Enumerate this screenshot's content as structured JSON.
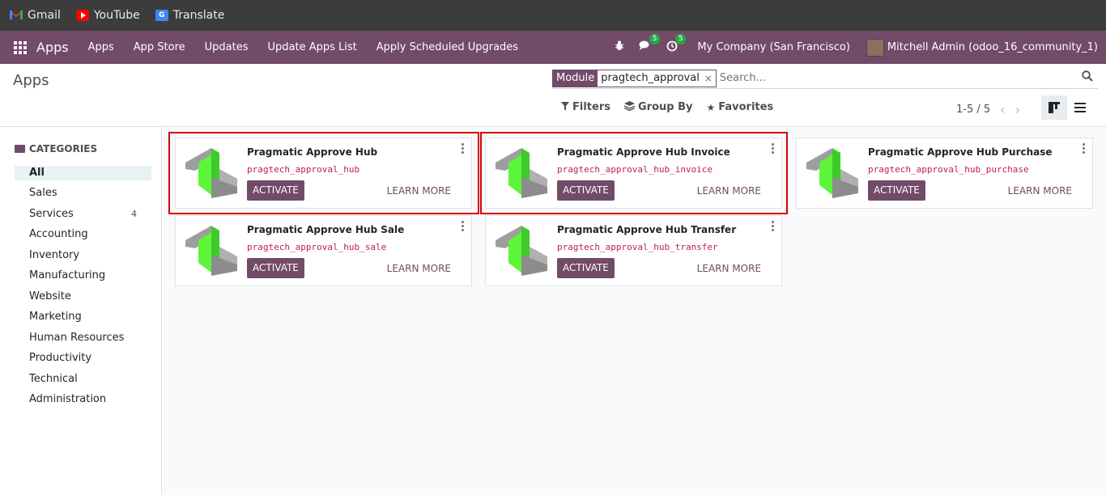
{
  "bookmarks": [
    {
      "label": "Gmail",
      "icon": "gmail-icon"
    },
    {
      "label": "YouTube",
      "icon": "youtube-icon"
    },
    {
      "label": "Translate",
      "icon": "translate-icon"
    }
  ],
  "navbar": {
    "brand": "Apps",
    "menu": [
      "Apps",
      "App Store",
      "Updates",
      "Update Apps List",
      "Apply Scheduled Upgrades"
    ],
    "messages_count": "5",
    "activities_count": "5",
    "company": "My Company (San Francisco)",
    "user": "Mitchell Admin (odoo_16_community_1)",
    "color": "#714b67"
  },
  "control_panel": {
    "breadcrumb": "Apps",
    "facet_label": "Module",
    "facet_value": "pragtech_approval",
    "facet_remove": "×",
    "search_placeholder": "Search...",
    "filters_label": "Filters",
    "groupby_label": "Group By",
    "favorites_label": "Favorites",
    "pager": "1-5 / 5"
  },
  "sidebar": {
    "heading": "CATEGORIES",
    "items": [
      {
        "label": "All",
        "count": ""
      },
      {
        "label": "Sales",
        "count": ""
      },
      {
        "label": "Services",
        "count": "4"
      },
      {
        "label": "Accounting",
        "count": ""
      },
      {
        "label": "Inventory",
        "count": ""
      },
      {
        "label": "Manufacturing",
        "count": ""
      },
      {
        "label": "Website",
        "count": ""
      },
      {
        "label": "Marketing",
        "count": ""
      },
      {
        "label": "Human Resources",
        "count": ""
      },
      {
        "label": "Productivity",
        "count": ""
      },
      {
        "label": "Technical",
        "count": ""
      },
      {
        "label": "Administration",
        "count": ""
      }
    ]
  },
  "cards": [
    {
      "name": "Pragmatic Approve Hub",
      "technical": "pragtech_approval_hub",
      "button": "ACTIVATE",
      "learn": "LEARN MORE"
    },
    {
      "name": "Pragmatic Approve Hub Invoice",
      "technical": "pragtech_approval_hub_invoice",
      "button": "ACTIVATE",
      "learn": "LEARN MORE"
    },
    {
      "name": "Pragmatic Approve Hub Purchase",
      "technical": "pragtech_approval_hub_purchase",
      "button": "ACTIVATE",
      "learn": "LEARN MORE"
    },
    {
      "name": "Pragmatic Approve Hub Sale",
      "technical": "pragtech_approval_hub_sale",
      "button": "ACTIVATE",
      "learn": "LEARN MORE"
    },
    {
      "name": "Pragmatic Approve Hub Transfer",
      "technical": "pragtech_approval_hub_transfer",
      "button": "ACTIVATE",
      "learn": "LEARN MORE"
    }
  ]
}
